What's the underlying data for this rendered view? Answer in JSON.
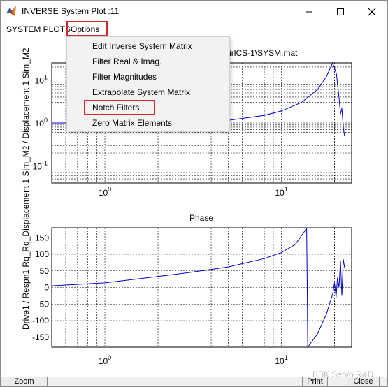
{
  "window": {
    "title": "INVERSE System Plot :11",
    "controls": {
      "minimize_icon": "minimize-icon",
      "maximize_icon": "maximize-icon",
      "close_icon": "close-icon"
    }
  },
  "menubar": {
    "items": [
      "SYSTEM PLOTS",
      "Options"
    ]
  },
  "options_menu": {
    "items": [
      "Edit Inverse System Matrix",
      "Filter Real & Imag.",
      "Filter Magnitudes",
      "Extrapolate System Matrix",
      "Notch Filters",
      "Zero Matrix Elements"
    ],
    "highlighted": "Notch Filters"
  },
  "plot": {
    "title_fragment": "stVirlCS-1\\SYSM.mat",
    "ylabel": "Drive1 / Respn1      Rq_Rq_Displacement 1 Sim_M2 / Displacement 1 Sim_M2",
    "phase_title": "Phase"
  },
  "chart_data": [
    {
      "type": "line",
      "name": "magnitude",
      "xscale": "log",
      "yscale": "log",
      "xlim": [
        0.5,
        25
      ],
      "ylim": [
        0.04,
        25
      ],
      "x_tick_labels": [
        "10^0",
        "10^1"
      ],
      "y_tick_labels": [
        "10^-1",
        "10^0",
        "10^1"
      ],
      "grid": true,
      "x": [
        0.5,
        0.8,
        1,
        2,
        3,
        5,
        8,
        10,
        13,
        16,
        18,
        19.5,
        20.5,
        21.2,
        21.6,
        22,
        22.4,
        22.8
      ],
      "y": [
        1.0,
        1.0,
        1.0,
        1.0,
        1.05,
        1.15,
        1.5,
        1.9,
        3,
        6,
        12,
        25,
        14,
        4,
        1.6,
        2.2,
        0.8,
        0.5
      ]
    },
    {
      "type": "line",
      "name": "phase",
      "title": "Phase",
      "xscale": "log",
      "xlim": [
        0.5,
        25
      ],
      "ylim": [
        -180,
        180
      ],
      "y_ticks": [
        -150,
        -100,
        -50,
        0,
        50,
        100,
        150
      ],
      "x_tick_labels": [
        "10^0",
        "10^1"
      ],
      "grid": true,
      "x": [
        0.5,
        1,
        2,
        3,
        5,
        8,
        10,
        12,
        13.9,
        14.0,
        14.1,
        16,
        18,
        19.5,
        19.6,
        20,
        20.4,
        20.8,
        21.2,
        21.6,
        22,
        22.4,
        22.8
      ],
      "y": [
        5,
        14,
        33,
        45,
        62,
        87,
        105,
        130,
        178,
        20,
        -180,
        -140,
        -80,
        -20,
        -15,
        15,
        -30,
        30,
        0,
        80,
        -25,
        85,
        60
      ]
    }
  ],
  "bottom_buttons": {
    "zoom": "Zoom",
    "print": "Print",
    "close": "Close"
  },
  "watermark": "BBK Servo R&D"
}
